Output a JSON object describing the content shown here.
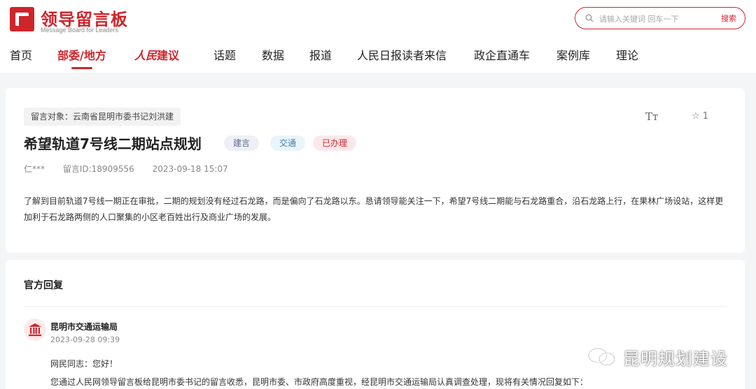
{
  "header": {
    "logo_title": "领导留言板",
    "logo_subtitle": "Message Board for Leaders",
    "search": {
      "placeholder": "请输入关键词 回车一下",
      "button_label": "搜索"
    },
    "nav": [
      {
        "label": "首页"
      },
      {
        "label": "部委/地方",
        "active": true
      },
      {
        "label_brand": "人民",
        "label_suffix": "建议"
      },
      {
        "label": "话题"
      },
      {
        "label": "数据"
      },
      {
        "label": "报道"
      },
      {
        "label": "人民日报读者来信"
      },
      {
        "label": "政企直通车"
      },
      {
        "label": "案例库"
      },
      {
        "label": "理论"
      }
    ]
  },
  "message": {
    "target": "留言对象：云南省昆明市委书记刘洪建",
    "font_toggle": "Tт",
    "star_count": "1",
    "title": "希望轨道7号线二期站点规划",
    "tags": [
      "建言",
      "交通",
      "已办理"
    ],
    "author": "仁***",
    "message_id": "留言ID:18909556",
    "datetime": "2023-09-18 15:07",
    "body": "了解到目前轨道7号线一期正在审批，二期的规划没有经过石龙路，而是偏向了石龙路以东。恳请领导能关注一下，希望7号线二期能与石龙路重合，沿石龙路上行，在果林广场设站，这样更加利于石龙路两侧的人口聚集的小区老百姓出行及商业广场的发展。"
  },
  "reply": {
    "section_title": "官方回复",
    "org_name": "昆明市交通运输局",
    "datetime": "2023-09-28 09:39",
    "greeting": "网民同志：您好！",
    "paragraph": "您通过人民网领导留言板给昆明市委书记的留言收悉，昆明市委、市政府高度重视，经昆明市交通运输局认真调查处理，现将有关情况回复如下："
  },
  "watermark": {
    "text": "昆明规划建设",
    "icon": "wechat-icon"
  },
  "colors": {
    "brand_red": "#d0242b",
    "background": "#f4f5f7"
  }
}
